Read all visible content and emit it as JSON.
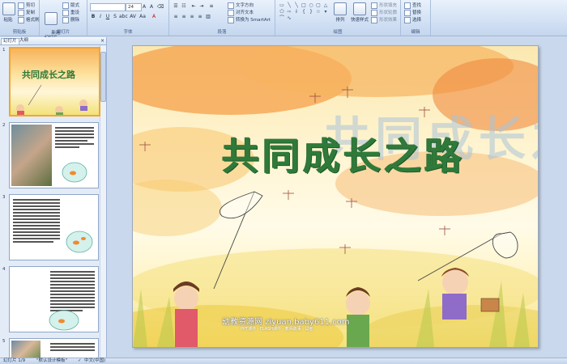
{
  "ribbon": {
    "clipboard": {
      "label": "剪贴板",
      "paste": "粘贴",
      "cut": "剪切",
      "copy": "复制",
      "format_painter": "格式刷"
    },
    "slides": {
      "label": "幻灯片",
      "new_slide": "新建\n幻灯片",
      "layout": "版式",
      "reset": "重设",
      "delete": "删除"
    },
    "font": {
      "label": "字体",
      "font_size": "24"
    },
    "paragraph": {
      "label": "段落",
      "text_direction": "文字方向",
      "align_text": "对齐文本",
      "convert_smartart": "转换为 SmartArt"
    },
    "drawing": {
      "label": "绘图",
      "arrange": "排列",
      "quick_styles": "快速样式",
      "shape_fill": "形状填充",
      "shape_outline": "形状轮廓",
      "shape_effects": "形状效果"
    },
    "editing": {
      "label": "编辑",
      "find": "查找",
      "replace": "替换",
      "select": "选择"
    }
  },
  "left_panel": {
    "tabs": [
      "幻灯片",
      "大纲"
    ],
    "close": "×",
    "thumbnails": [
      {
        "number": "1",
        "title": "共同成长之路"
      },
      {
        "number": "2",
        "caption": "午饭时间，同学们都围着杯子大口大口地吃饭"
      },
      {
        "number": "3",
        "caption": "第三天，看到小金鱼在鱼缸里游来游去"
      },
      {
        "number": "4",
        "caption": "为了试验小金鱼是否能够在鱼缸里生活"
      },
      {
        "number": "5",
        "caption": ""
      }
    ]
  },
  "slide": {
    "title": "共同成长之路",
    "ghost_text": "共同成长之路",
    "watermark": "幼教资源网 ziyuan.baby611.com",
    "watermark_sub": "PPT课件 · FLASH课件 · 教师故事 · 试卷"
  },
  "status_bar": {
    "slide_info": "幻灯片 1/9",
    "theme": "\"默认设计模板\"",
    "language": "中文(中国)"
  },
  "colors": {
    "title_green": "#2f7a3a",
    "ribbon_bg": "#d2e1f4",
    "selection": "#f0a630"
  }
}
